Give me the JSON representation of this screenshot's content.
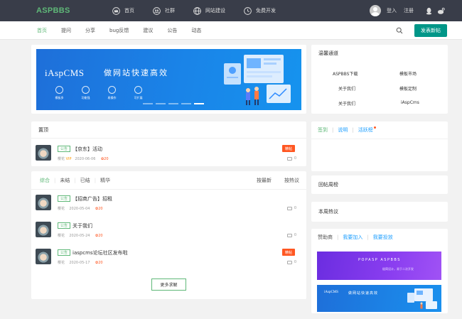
{
  "brand": {
    "logo": "ASPBBS",
    "accent": "#5fb878",
    "primary": "#009688",
    "danger": "#ff5722",
    "dark": "#393d49"
  },
  "topnav": [
    {
      "label": "首页",
      "icon": "crown-icon"
    },
    {
      "label": "社群",
      "icon": "group-icon"
    },
    {
      "label": "网站建设",
      "icon": "globe-icon"
    },
    {
      "label": "免费开发",
      "icon": "clock-icon"
    }
  ],
  "user": {
    "login": "登入",
    "register": "注册"
  },
  "subnav": {
    "items": [
      "首页",
      "提问",
      "分享",
      "bug反馈",
      "建议",
      "公告",
      "动态"
    ],
    "post_label": "发表新帖"
  },
  "banner": {
    "title": "iAspCMS",
    "slogan": "做网站快速高效",
    "features": [
      "模板多",
      "功能强",
      "易操作",
      "可扩展"
    ]
  },
  "top": {
    "heading": "置顶",
    "items": [
      {
        "tag": "公告",
        "title": "【京东】活动",
        "user": "樱花",
        "vip": "VIP",
        "date": "2020-06-06",
        "reward": "20",
        "badge": "精帖",
        "comments": "0"
      }
    ]
  },
  "list": {
    "tabs": [
      "综合",
      "未结",
      "已结",
      "精华"
    ],
    "sort": [
      "按最新",
      "按热议"
    ],
    "items": [
      {
        "tag": "公告",
        "title": "【招商广告】招租",
        "user": "樱花",
        "date": "2020-05-04",
        "reward": "20",
        "badge": "",
        "comments": "0"
      },
      {
        "tag": "公告",
        "title": "关于我们",
        "user": "樱花",
        "date": "2020-05-24",
        "reward": "20",
        "badge": "",
        "comments": "0"
      },
      {
        "tag": "公告",
        "title": "iaspcms论坛社区发布啦",
        "user": "樱花",
        "date": "2020-05-17",
        "reward": "20",
        "badge": "精帖",
        "comments": "0"
      }
    ],
    "more_label": "更多求解"
  },
  "recommend": {
    "heading": "温馨通道",
    "links": [
      "ASPBBS下载",
      "模板市场",
      "关于我们",
      "模板定制",
      "关于我们",
      "iAspCms"
    ]
  },
  "signin": {
    "tabs": [
      "签到",
      "说明",
      "活跃榜"
    ]
  },
  "reply_heading": "回帖周榜",
  "hot_heading": "本周热议",
  "ads": {
    "tabs": [
      "赞助商",
      "我要加入",
      "我要投放"
    ],
    "ad1_title": "POPASP ASPBBS",
    "ad1_sub": "极简设计，易于二次开发",
    "ad2_title": "iAspCMS",
    "ad2_slogan": "做网站快速高效"
  }
}
